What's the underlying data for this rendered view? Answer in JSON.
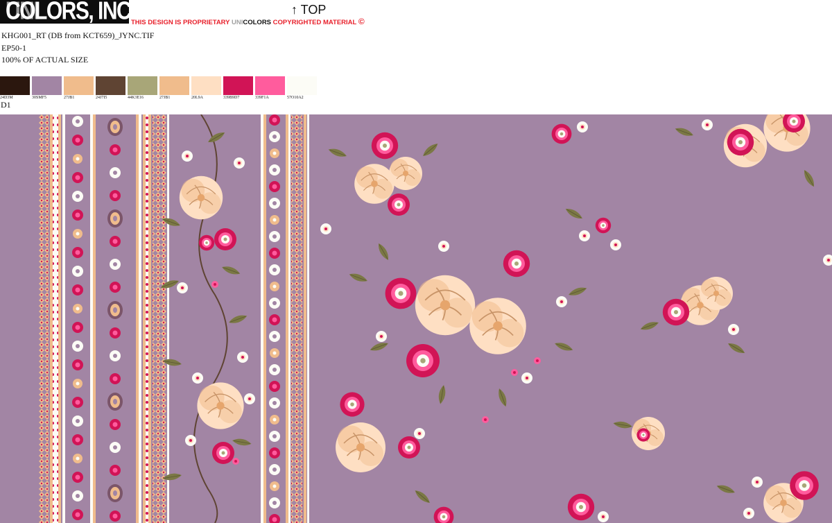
{
  "header": {
    "logo_uni": "UNI",
    "logo_rest": "COLORS, INC.",
    "notice": {
      "prefix": "THIS DESIGN IS PROPRIETARY ",
      "uni": "UNI",
      "colors": "COLORS",
      "suffix": " COPYRIGHTED MATERIAL ",
      "copyright": "©"
    },
    "top_label": "↑ TOP"
  },
  "meta": {
    "filename": "KHG001_RT (DB from KCT659)_JYNC.TIF",
    "code": "EP50-1",
    "scale": "100% OF ACTUAL SIZE"
  },
  "swatches": [
    {
      "code": "24D3M",
      "color": "#2b170e"
    },
    {
      "code": "30SMF5",
      "color": "#a285a4"
    },
    {
      "code": "27JB1",
      "color": "#f0bc8c"
    },
    {
      "code": "24J7I5",
      "color": "#5f4433"
    },
    {
      "code": "44K3E16",
      "color": "#a8a678"
    },
    {
      "code": "27JB1",
      "color": "#f0bc8c"
    },
    {
      "code": "20L9A",
      "color": "#fedfc3"
    },
    {
      "code": "339B9D7",
      "color": "#d11456"
    },
    {
      "code": "339F1A",
      "color": "#ff5c9d"
    },
    {
      "code": "57O10A2",
      "color": "#fcfcf6"
    }
  ],
  "design_label": "D1",
  "colors": {
    "ground": "#a285a4",
    "dark_brown": "#2b170e",
    "peach": "#f0bc8c",
    "brown": "#5f4433",
    "olive": "#a8a678",
    "leaf": "#7b7845",
    "cream": "#fedfc3",
    "magenta": "#d11456",
    "pink": "#ff5c9d",
    "white": "#fcfcf6"
  }
}
